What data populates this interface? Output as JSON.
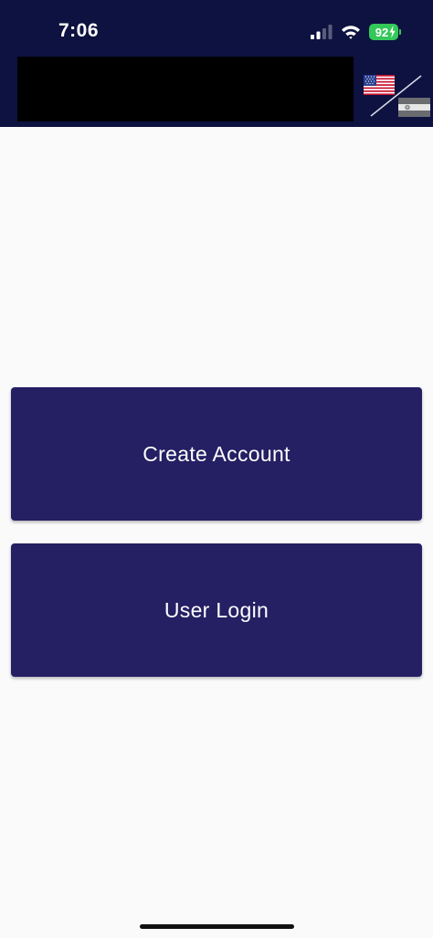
{
  "status_bar": {
    "time": "7:06",
    "battery_level": "92",
    "battery_color": "#34c759",
    "icons": [
      "cellular-signal-icon",
      "wifi-icon",
      "battery-charging-icon"
    ]
  },
  "header": {
    "background_color": "#0e1240",
    "language_toggle": {
      "icons": [
        "us-flag-icon",
        "other-flag-icon"
      ]
    }
  },
  "actions": {
    "button_color": "#251f63",
    "create_account_label": "Create Account",
    "user_login_label": "User Login"
  }
}
